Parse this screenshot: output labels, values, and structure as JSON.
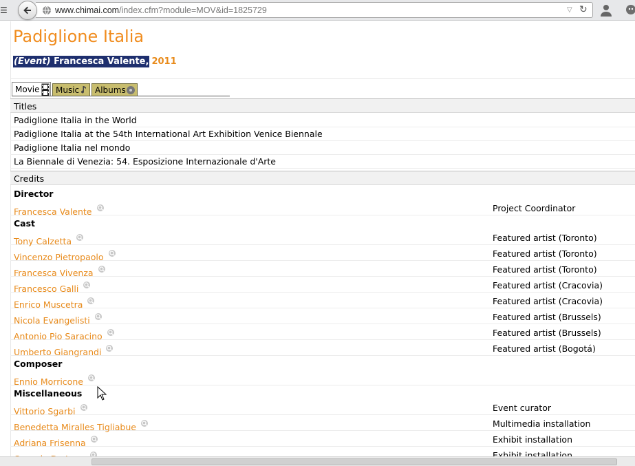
{
  "browser": {
    "url_domain": "www.chimai.com",
    "url_path": "/index.cfm?module=MOV&id=1825729"
  },
  "page": {
    "title": "Padiglione Italia",
    "event_tag": "(Event)",
    "author": "Francesca Valente,",
    "year": "2011"
  },
  "tabs": [
    {
      "label": "Movie",
      "icon": "film-icon",
      "active": true
    },
    {
      "label": "Music",
      "icon": "note-icon",
      "active": false
    },
    {
      "label": "Albums",
      "icon": "disc-icon",
      "active": false
    }
  ],
  "titles": {
    "header": "Titles",
    "items": [
      "Padiglione Italia in the World",
      "Padiglione Italia at the 54th International Art Exhibition Venice Biennale",
      "Padiglione Italia nel mondo",
      "La Biennale di Venezia: 54. Esposizione Internazionale d'Arte"
    ]
  },
  "credits": {
    "header": "Credits",
    "groups": {
      "director": "Director",
      "cast": "Cast",
      "composer": "Composer",
      "misc": "Miscellaneous"
    },
    "director": [
      {
        "name": "Francesca Valente",
        "role": "Project Coordinator"
      }
    ],
    "cast": [
      {
        "name": "Tony Calzetta",
        "role": "Featured artist (Toronto)"
      },
      {
        "name": "Vincenzo Pietropaolo",
        "role": "Featured artist (Toronto)"
      },
      {
        "name": "Francesca Vivenza",
        "role": "Featured artist (Toronto)"
      },
      {
        "name": "Francesco Galli",
        "role": "Featured artist (Cracovia)"
      },
      {
        "name": "Enrico Muscetra",
        "role": "Featured artist (Cracovia)"
      },
      {
        "name": "Nicola Evangelisti",
        "role": "Featured artist (Brussels)"
      },
      {
        "name": "Antonio Pio Saracino",
        "role": "Featured artist (Brussels)"
      },
      {
        "name": "Umberto Giangrandi",
        "role": "Featured artist (Bogotá)"
      }
    ],
    "composer": [
      {
        "name": "Ennio Morricone",
        "role": ""
      }
    ],
    "misc": [
      {
        "name": "Vittorio Sgarbi",
        "role": "Event curator"
      },
      {
        "name": "Benedetta Miralles Tigliabue",
        "role": "Multimedia installation"
      },
      {
        "name": "Adriana Frisenna",
        "role": "Exhibit installation"
      },
      {
        "name": "Corrado De Luca",
        "role": "Exhibit installation"
      }
    ]
  },
  "colors": {
    "accent_orange": "#f08c1e",
    "highlight_navy": "#1e2f6e",
    "tab_khaki": "#c8bd6e"
  }
}
